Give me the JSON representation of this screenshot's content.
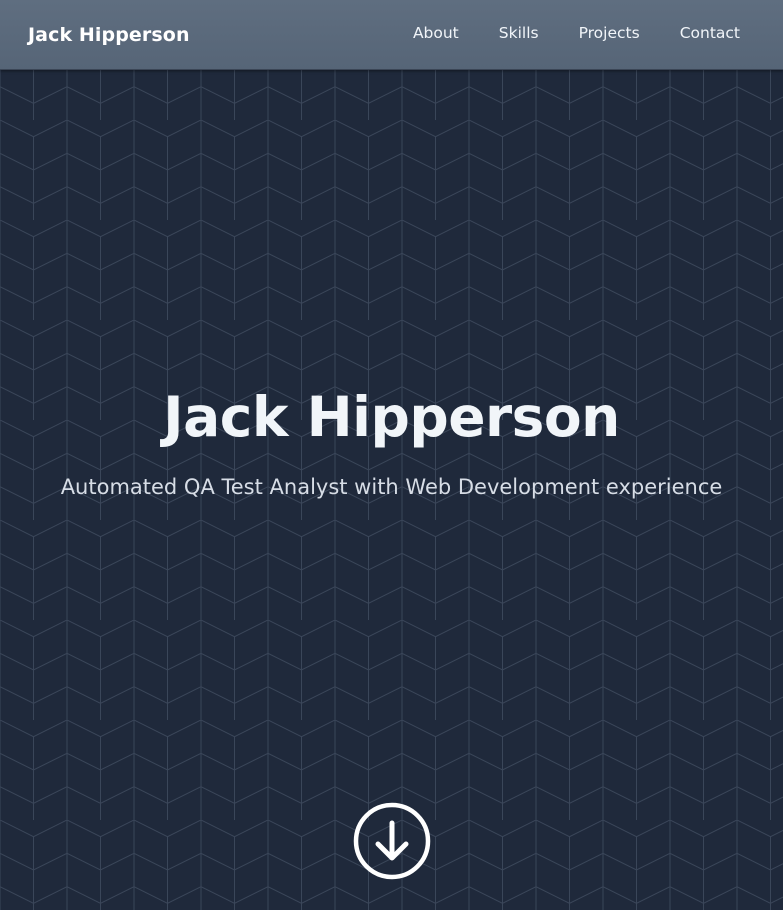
{
  "navbar": {
    "brand": "Jack Hipperson",
    "links": [
      "About",
      "Skills",
      "Projects",
      "Contact"
    ]
  },
  "hero": {
    "title": "Jack Hipperson",
    "subtitle": "Automated QA Test Analyst with Web Development experience",
    "scroll_icon": "arrow-down-circle-icon"
  },
  "colors": {
    "navbar_bg": "#5a697b",
    "hero_bg": "#1f293b",
    "pattern_line": "#3a4659",
    "text": "#f1f5f9"
  }
}
